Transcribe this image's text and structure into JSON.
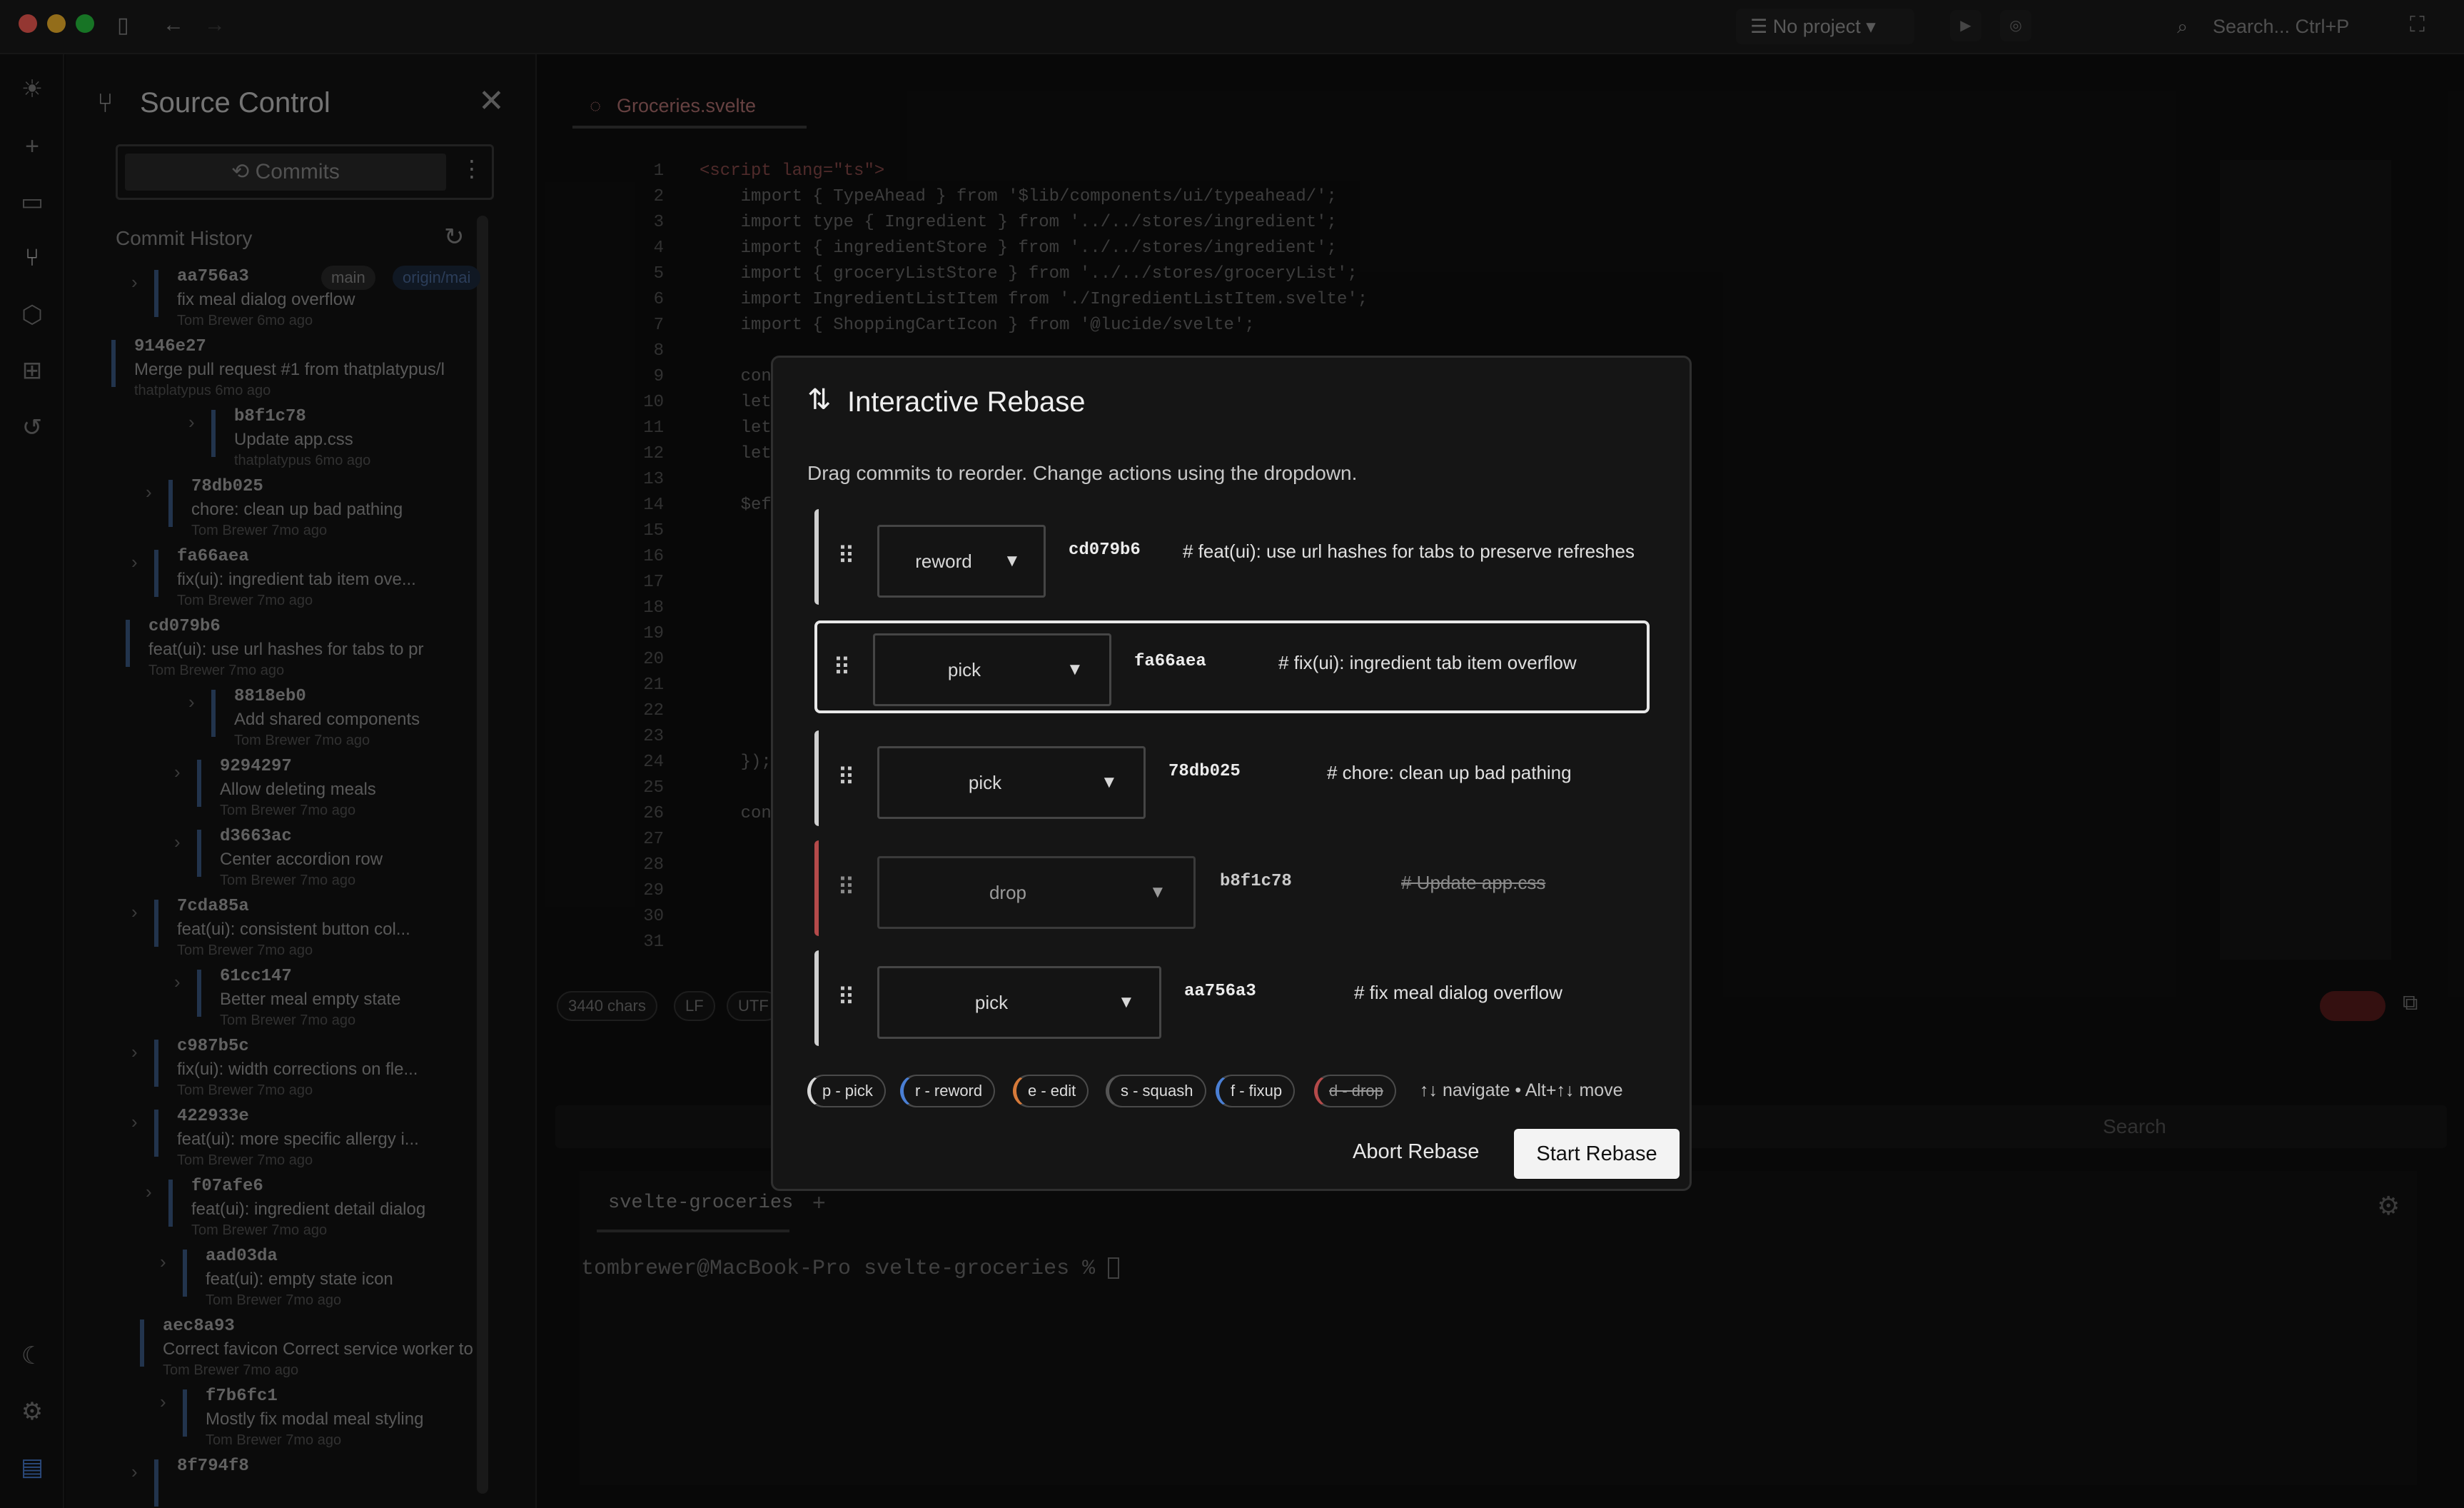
{
  "titlebar": {
    "project": "No project",
    "search_placeholder": "Search... Ctrl+P"
  },
  "source_control": {
    "title": "Source Control",
    "tab_commits": "Commits",
    "history_label": "Commit History",
    "commits": [
      {
        "hash": "aa756a3",
        "msg": "fix meal dialog overflow",
        "meta": "Tom Brewer  6mo ago",
        "badges": [
          "main",
          "origin/mai"
        ]
      },
      {
        "hash": "9146e27",
        "msg": "Merge pull request #1 from thatplatypus/l",
        "meta": "thatplatypus  6mo ago"
      },
      {
        "hash": "b8f1c78",
        "msg": "Update app.css",
        "meta": "thatplatypus  6mo ago"
      },
      {
        "hash": "78db025",
        "msg": "chore: clean up bad pathing",
        "meta": "Tom Brewer  7mo ago"
      },
      {
        "hash": "fa66aea",
        "msg": "fix(ui): ingredient tab item ove...",
        "meta": "Tom Brewer  7mo ago"
      },
      {
        "hash": "cd079b6",
        "msg": "feat(ui): use url hashes for tabs to pr",
        "meta": "Tom Brewer  7mo ago"
      },
      {
        "hash": "8818eb0",
        "msg": "Add shared components",
        "meta": "Tom Brewer  7mo ago"
      },
      {
        "hash": "9294297",
        "msg": "Allow deleting meals",
        "meta": "Tom Brewer  7mo ago"
      },
      {
        "hash": "d3663ac",
        "msg": "Center accordion row",
        "meta": "Tom Brewer  7mo ago"
      },
      {
        "hash": "7cda85a",
        "msg": "feat(ui): consistent button col...",
        "meta": "Tom Brewer  7mo ago"
      },
      {
        "hash": "61cc147",
        "msg": "Better meal empty state",
        "meta": "Tom Brewer  7mo ago"
      },
      {
        "hash": "c987b5c",
        "msg": "fix(ui): width corrections on fle...",
        "meta": "Tom Brewer  7mo ago"
      },
      {
        "hash": "422933e",
        "msg": "feat(ui): more specific allergy i...",
        "meta": "Tom Brewer  7mo ago"
      },
      {
        "hash": "f07afe6",
        "msg": "feat(ui): ingredient detail dialog",
        "meta": "Tom Brewer  7mo ago"
      },
      {
        "hash": "aad03da",
        "msg": "feat(ui): empty state icon",
        "meta": "Tom Brewer  7mo ago"
      },
      {
        "hash": "aec8a93",
        "msg": "Correct favicon Correct service worker to",
        "meta": "Tom Brewer  7mo ago"
      },
      {
        "hash": "f7b6fc1",
        "msg": "Mostly fix modal meal styling",
        "meta": "Tom Brewer  7mo ago"
      },
      {
        "hash": "8f794f8",
        "msg": "",
        "meta": ""
      }
    ]
  },
  "editor": {
    "tab": "Groceries.svelte",
    "lines": [
      "<script lang=\"ts\">",
      "    import { TypeAhead } from '$lib/components/ui/typeahead/';",
      "    import type { Ingredient } from '../../stores/ingredient';",
      "    import { ingredientStore } from '../../stores/ingredient';",
      "    import { groceryListStore } from '../../stores/groceryList';",
      "    import IngredientListItem from './IngredientListItem.svelte';",
      "    import { ShoppingCartIcon } from '@lucide/svelte';",
      "",
      "    con",
      "    let",
      "    let",
      "    let",
      "",
      "    $ef",
      "",
      "",
      "",
      "",
      "",
      "",
      "",
      "",
      "",
      "    });",
      "",
      "    con",
      "",
      "",
      "",
      "",
      ""
    ],
    "status_chars": "3440 chars",
    "status_eol": "LF",
    "status_enc": "UTF"
  },
  "terminal": {
    "search": "Search",
    "tab": "svelte-groceries",
    "prompt": "tombrewer@MacBook-Pro svelte-groceries % "
  },
  "modal": {
    "title": "Interactive Rebase",
    "description": "Drag commits to reorder. Change actions using the dropdown.",
    "rows": [
      {
        "action": "reword",
        "hash": "cd079b6",
        "note": "# feat(ui): use url hashes for tabs to preserve refreshes",
        "color": "#4a7fd4"
      },
      {
        "action": "pick",
        "hash": "fa66aea",
        "note": "# fix(ui): ingredient tab item overflow",
        "color": "#e8e8e8"
      },
      {
        "action": "pick",
        "hash": "78db025",
        "note": "# chore: clean up bad pathing",
        "color": "#e8e8e8"
      },
      {
        "action": "drop",
        "hash": "b8f1c78",
        "note": "# Update app.css",
        "color": "#b44a4a"
      },
      {
        "action": "pick",
        "hash": "aa756a3",
        "note": "# fix meal dialog overflow",
        "color": "#e8e8e8"
      }
    ],
    "shortcuts": [
      {
        "label": "p - pick",
        "color": "#d8d8d8"
      },
      {
        "label": "r - reword",
        "color": "#4a7fd4"
      },
      {
        "label": "e - edit",
        "color": "#d67a3a"
      },
      {
        "label": "s - squash",
        "color": "#555555"
      },
      {
        "label": "f - fixup",
        "color": "#4a7fd4"
      },
      {
        "label": "d - drop",
        "color": "#b44a4a"
      }
    ],
    "hint": "↑↓ navigate • Alt+↑↓ move",
    "abort_label": "Abort Rebase",
    "start_label": "Start Rebase"
  }
}
